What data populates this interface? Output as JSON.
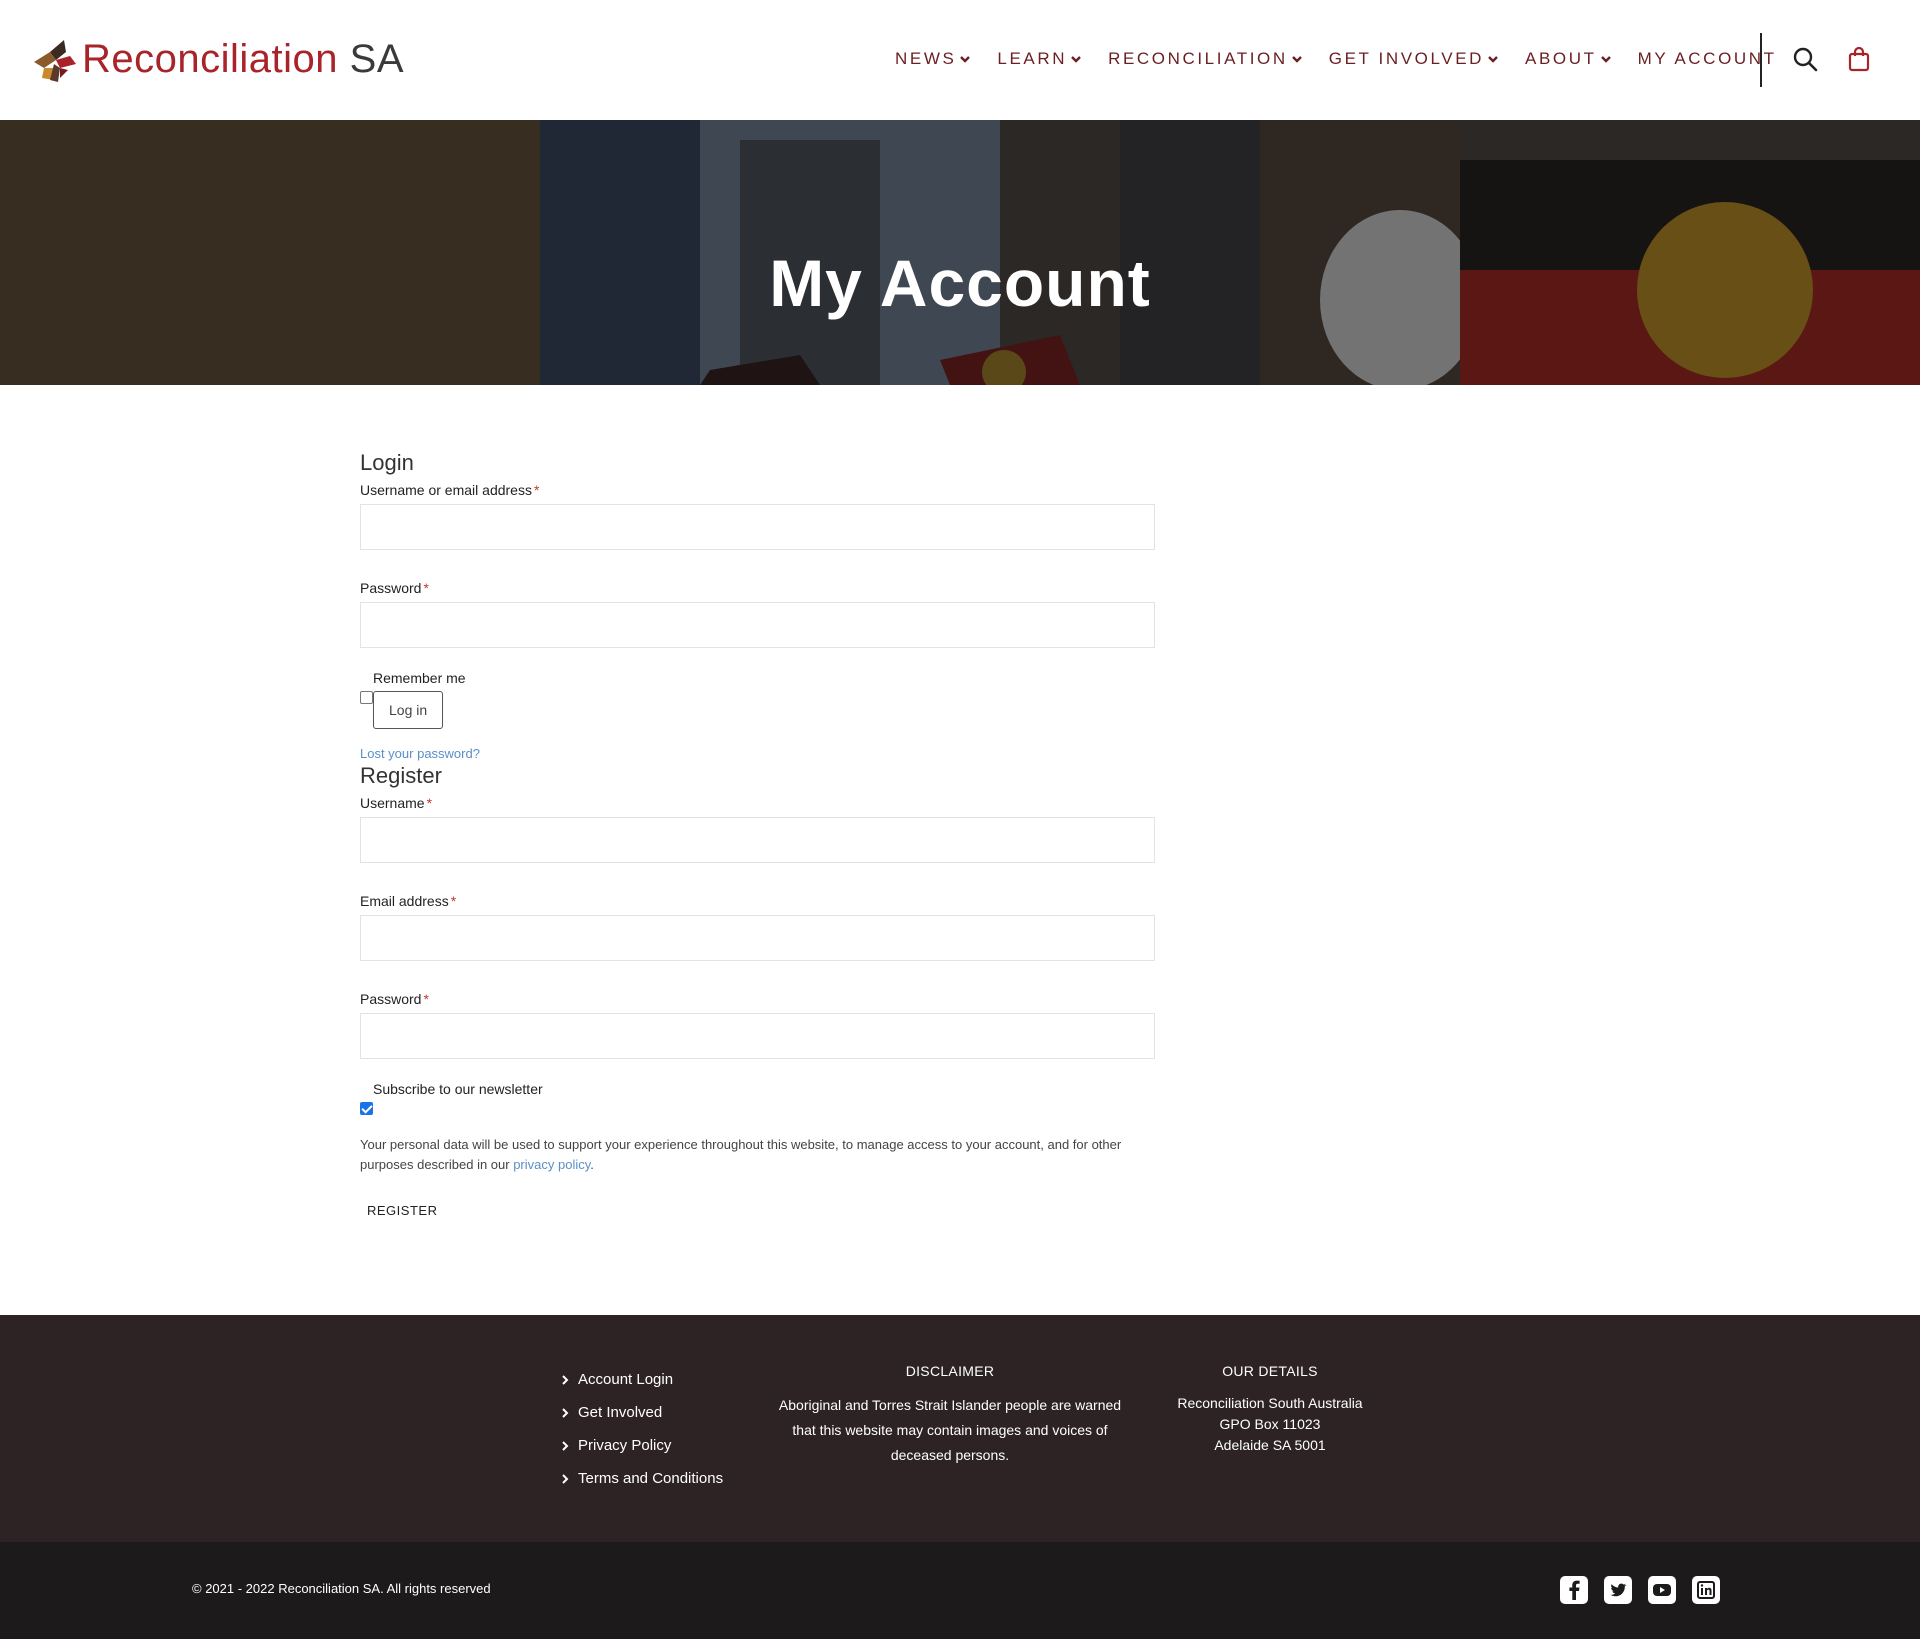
{
  "brand": {
    "name_part1": "Reconciliation",
    "name_part2": "SA",
    "colors": {
      "primary": "#a8232a",
      "nav_text": "#6b1f22",
      "footer_bg": "#2d2325",
      "footer_bottom_bg": "#1c1a1b",
      "link": "#5a8fc8"
    }
  },
  "nav": {
    "items": [
      {
        "label": "NEWS",
        "has_dropdown": true
      },
      {
        "label": "LEARN",
        "has_dropdown": true
      },
      {
        "label": "RECONCILIATION",
        "has_dropdown": true
      },
      {
        "label": "GET INVOLVED",
        "has_dropdown": true
      },
      {
        "label": "ABOUT",
        "has_dropdown": true
      },
      {
        "label": "MY ACCOUNT",
        "has_dropdown": false
      }
    ],
    "icons": [
      "search-icon",
      "shopping-bag-icon"
    ]
  },
  "hero": {
    "title": "My Account"
  },
  "login": {
    "heading": "Login",
    "username_label": "Username or email address",
    "password_label": "Password",
    "required_mark": "*",
    "remember_label": "Remember me",
    "remember_checked": false,
    "submit_label": "Log in",
    "lost_password": "Lost your password?"
  },
  "register": {
    "heading": "Register",
    "username_label": "Username",
    "email_label": "Email address",
    "password_label": "Password",
    "required_mark": "*",
    "newsletter_label": "Subscribe to our newsletter",
    "newsletter_checked": true,
    "privacy_text_before": "Your personal data will be used to support your experience throughout this website, to manage access to your account, and for other purposes described in our ",
    "privacy_link": "privacy policy",
    "privacy_text_after": ".",
    "submit_label": "REGISTER"
  },
  "footer": {
    "links": [
      "Account Login",
      "Get Involved",
      "Privacy Policy",
      "Terms and Conditions"
    ],
    "disclaimer": {
      "heading": "DISCLAIMER",
      "line1": "Aboriginal and Torres Strait Islander people are warned",
      "line2": "that this website may contain images and voices of",
      "line3": "deceased persons."
    },
    "details": {
      "heading": "OUR DETAILS",
      "line1": "Reconciliation South Australia",
      "line2": "GPO Box 11023",
      "line3": "Adelaide SA 5001"
    },
    "copyright": "© 2021 - 2022 Reconciliation SA. All rights reserved",
    "social": [
      "facebook-icon",
      "twitter-icon",
      "youtube-icon",
      "linkedin-icon"
    ]
  }
}
